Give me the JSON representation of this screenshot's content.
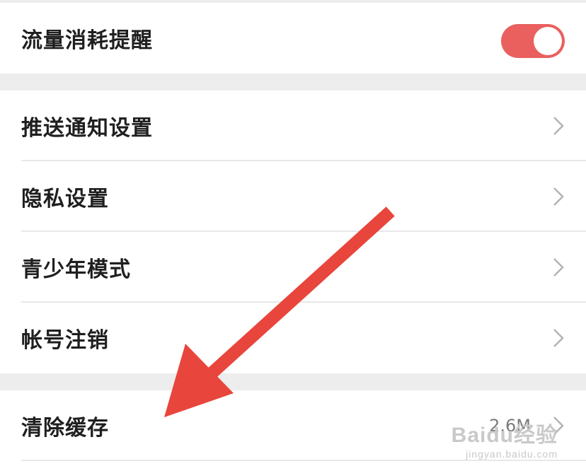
{
  "settings": {
    "traffic": {
      "label": "流量消耗提醒",
      "enabled": true
    },
    "push": {
      "label": "推送通知设置"
    },
    "privacy": {
      "label": "隐私设置"
    },
    "teen": {
      "label": "青少年模式"
    },
    "account": {
      "label": "帐号注销"
    },
    "cache": {
      "label": "清除缓存",
      "value": "2.6M"
    }
  },
  "watermark": {
    "brand": "Baidu经验",
    "url": "jingyan.baidu.com"
  },
  "colors": {
    "toggle_on": "#e9605e",
    "annotation_arrow": "#e8453c"
  },
  "icons": {
    "chevron": "chevron-right-icon"
  }
}
